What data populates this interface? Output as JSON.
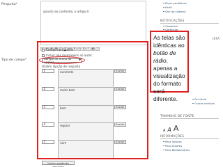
{
  "form": {
    "question_label": "Pergunta*",
    "question_text": "quanto ao conteúdo, o artigo é:",
    "type_label": "Tipo de campo*",
    "required_label": "Campo obrigatório",
    "include_in_messages_label": "Incluir nas mensagens ao autor",
    "field_type_value": "Campo de menu de opções",
    "col_order": "Ordem",
    "col_option": "Opção de resposta",
    "delete_label": "Excluir",
    "add_option_label": "Incluir opção de resposta",
    "options": [
      {
        "order": "1",
        "text": "excelente"
      },
      {
        "order": "2",
        "text": "muito bom"
      },
      {
        "order": "3",
        "text": "bom"
      },
      {
        "order": "4",
        "text": "regular"
      },
      {
        "order": "5",
        "text": "ruim"
      }
    ]
  },
  "sidebar": {
    "top_links": [
      "Meus periódicos",
      "Perfil",
      "Sair do sistema"
    ],
    "notifications_title": "NOTIFICAÇÕES",
    "notifications_links": [
      "Visualizar",
      "Gerenciar"
    ],
    "partial_title": "ISTA",
    "mid_links": [
      "Por título",
      "Outras revistas"
    ],
    "font_size_title": "TAMANHO DE FONTE",
    "font_glyphs": [
      "A",
      "A",
      "A"
    ],
    "info_title": "INFORMAÇÕES",
    "info_links": [
      "Para leitores",
      "Para Autores",
      "Para Bibliotecários"
    ]
  },
  "callout": {
    "line1": "As telas são idênticas ao",
    "italic": "botão de rádio",
    "line2": ", apenas a visualização do formato será diferente."
  },
  "colors": {
    "annotation_red": "#e01f1f",
    "link": "#335577"
  }
}
